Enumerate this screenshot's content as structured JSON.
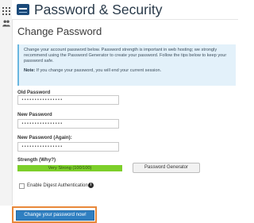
{
  "header": {
    "title": "Password & Security"
  },
  "section": {
    "title": "Change Password"
  },
  "info": {
    "text": "Change your account password below. Password strength is important in web hosting; we strongly recommend using the Password Generator to create your password. Follow the tips below to keep your password safe.",
    "note_label": "Note:",
    "note_text": " If you change your password, you will end your current session."
  },
  "form": {
    "old_password": {
      "label": "Old Password",
      "value": "••••••••••••••••"
    },
    "new_password": {
      "label": "New Password",
      "value": "••••••••••••••••"
    },
    "new_password_again": {
      "label": "New Password (Again):",
      "value": "••••••••••••••••"
    },
    "strength": {
      "label": "Strength (Why?)",
      "text": "Very Strong (100/100)",
      "score": 100,
      "color": "#7dcf2a"
    },
    "generator_button": "Password Generator",
    "digest_label": "Enable Digest Authentication",
    "submit_button": "Change your password now!"
  },
  "icons": [
    "grid-icon",
    "users-icon",
    "app-logo-icon",
    "info-icon"
  ]
}
